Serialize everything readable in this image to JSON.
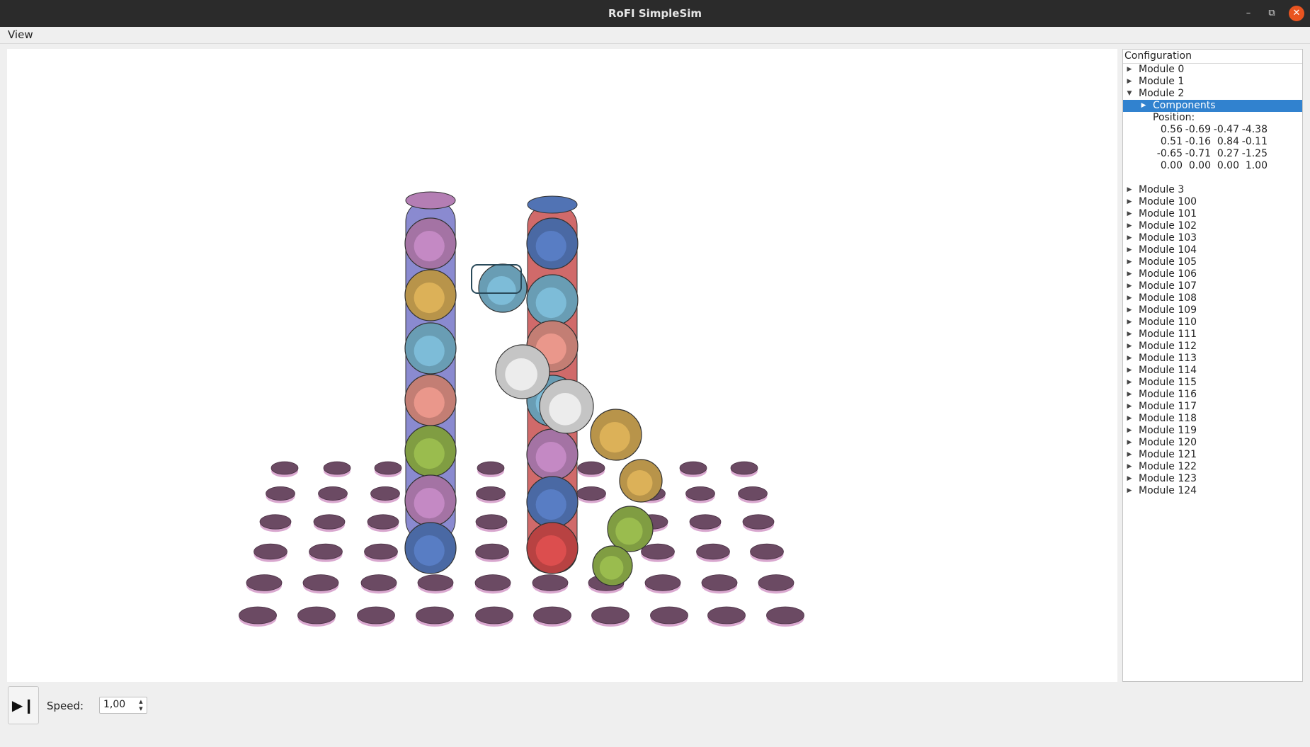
{
  "window": {
    "title": "RoFI SimpleSim"
  },
  "menu": {
    "view": "View"
  },
  "tree": {
    "header": "Configuration",
    "modules_before": [
      "Module 0",
      "Module 1"
    ],
    "expanded_module": "Module 2",
    "components_label": "Components",
    "position_label": "Position:",
    "position_matrix": [
      [
        "0.56",
        "-0.69",
        "-0.47",
        "-4.38"
      ],
      [
        "0.51",
        "-0.16",
        "0.84",
        "-0.11"
      ],
      [
        "-0.65",
        "-0.71",
        "0.27",
        "-1.25"
      ],
      [
        "0.00",
        "0.00",
        "0.00",
        "1.00"
      ]
    ],
    "modules_after": [
      "Module 3",
      "Module 100",
      "Module 101",
      "Module 102",
      "Module 103",
      "Module 104",
      "Module 105",
      "Module 106",
      "Module 107",
      "Module 108",
      "Module 109",
      "Module 110",
      "Module 111",
      "Module 112",
      "Module 113",
      "Module 114",
      "Module 115",
      "Module 116",
      "Module 117",
      "Module 118",
      "Module 119",
      "Module 120",
      "Module 121",
      "Module 122",
      "Module 123",
      "Module 124"
    ]
  },
  "controls": {
    "play_icon": "play-pause-icon",
    "speed_label": "Speed:",
    "speed_value": "1,00"
  },
  "colors": {
    "accent": "#3182cf",
    "close": "#e95420",
    "pad": "#6b4a63",
    "module_colors": [
      "#c88cc8",
      "#e0b45a",
      "#80c0dc",
      "#ee9a8e",
      "#9cc050",
      "#5a80c8",
      "#e05050",
      "#f0f0f0"
    ]
  }
}
